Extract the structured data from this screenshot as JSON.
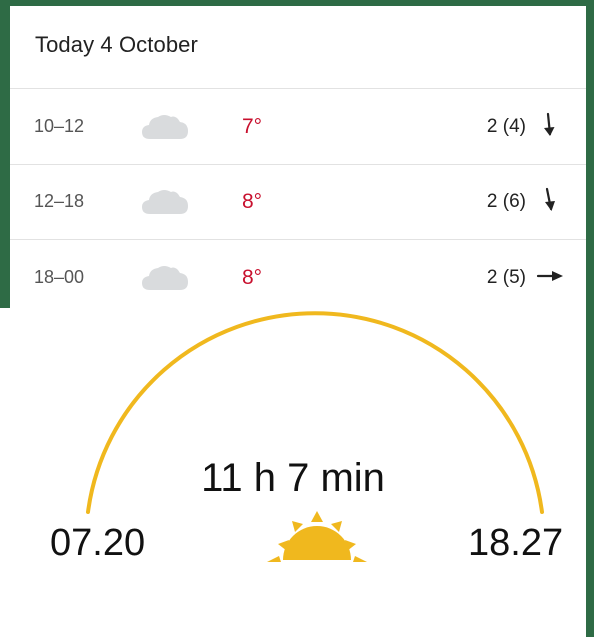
{
  "forecast": {
    "title": "Today 4 October",
    "rows": [
      {
        "time": "10–12",
        "icon": "cloud-icon",
        "temp": "7°",
        "wind": "2 (4)",
        "wind_direction_icon": "arrow-down-icon"
      },
      {
        "time": "12–18",
        "icon": "cloud-icon",
        "temp": "8°",
        "wind": "2 (6)",
        "wind_direction_icon": "arrow-down-icon"
      },
      {
        "time": "18–00",
        "icon": "cloud-icon",
        "temp": "8°",
        "wind": "2 (5)",
        "wind_direction_icon": "arrow-right-icon"
      }
    ]
  },
  "sun": {
    "day_length": "11 h 7 min",
    "sunrise": "07.20",
    "sunset": "18.27",
    "icon": "sun-icon"
  },
  "colors": {
    "temperature": "#c8102e",
    "sun_arc": "#f0b81e",
    "cloud": "#d9dbdd",
    "background": "#2e6b45"
  }
}
